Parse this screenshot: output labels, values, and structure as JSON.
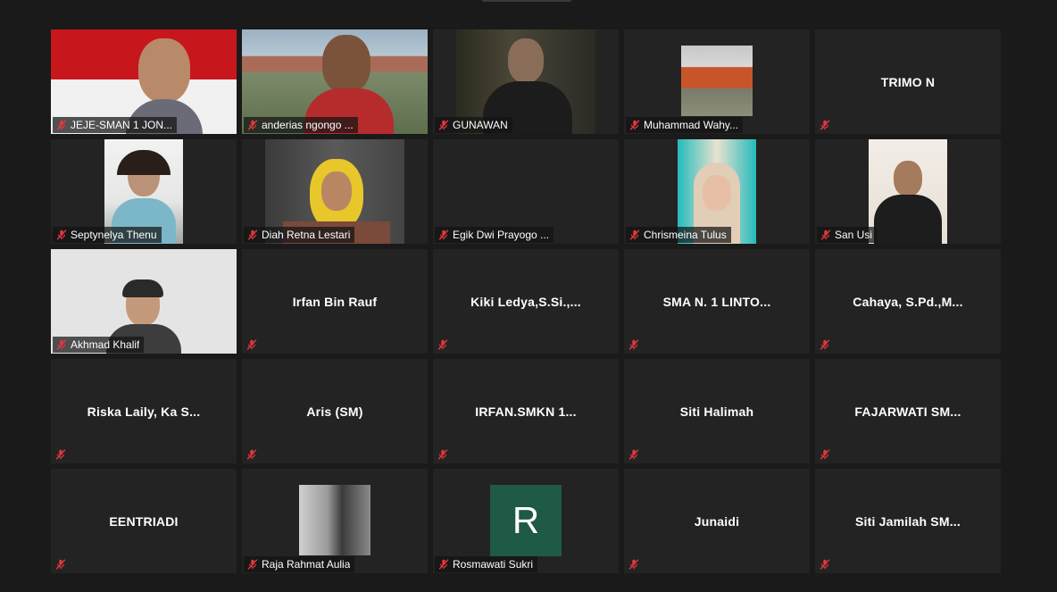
{
  "participants": [
    {
      "name": "JEJE-SMAN 1 JON...",
      "has_video": true,
      "video_style": "flag"
    },
    {
      "name": "anderias ngongo ...",
      "has_video": true,
      "video_style": "outdoor"
    },
    {
      "name": "GUNAWAN",
      "has_video": true,
      "video_style": "dark-room"
    },
    {
      "name": "Muhammad Wahy...",
      "has_video": true,
      "video_style": "building"
    },
    {
      "name": "TRIMO  N",
      "has_video": false,
      "show_name_label": false
    },
    {
      "name": "Septynelya Thenu",
      "has_video": true,
      "video_style": "portrait-light"
    },
    {
      "name": "Diah Retna Lestari",
      "has_video": true,
      "video_style": "portrait-yellow"
    },
    {
      "name": "Egik Dwi Prayogo ...",
      "has_video": true,
      "video_style": "blank"
    },
    {
      "name": "Chrismeina Tulus",
      "has_video": true,
      "video_style": "portrait-teal"
    },
    {
      "name": "San Usi",
      "has_video": true,
      "video_style": "portrait-dark"
    },
    {
      "name": "Akhmad Khalif",
      "has_video": true,
      "video_style": "portrait-wall"
    },
    {
      "name": "Irfan Bin Rauf",
      "has_video": false,
      "show_name_label": false
    },
    {
      "name": "Kiki  Ledya,S.Si.,...",
      "has_video": false,
      "show_name_label": false
    },
    {
      "name": "SMA N. 1 LINTO...",
      "has_video": false,
      "show_name_label": false
    },
    {
      "name": "Cahaya,  S.Pd.,M...",
      "has_video": false,
      "show_name_label": false
    },
    {
      "name": "Riska Laily, Ka S...",
      "has_video": false,
      "show_name_label": false
    },
    {
      "name": "Aris (SM)",
      "has_video": false,
      "show_name_label": false
    },
    {
      "name": "IRFAN.SMKN  1...",
      "has_video": false,
      "show_name_label": false
    },
    {
      "name": "Siti Halimah",
      "has_video": false,
      "show_name_label": false
    },
    {
      "name": "FAJARWATI SM...",
      "has_video": false,
      "show_name_label": false
    },
    {
      "name": "EENTRIADI",
      "has_video": false,
      "show_name_label": false
    },
    {
      "name": "Raja Rahmat Aulia",
      "has_video": true,
      "video_style": "bw-photo"
    },
    {
      "name": "Rosmawati Sukri",
      "has_video": true,
      "video_style": "avatar-letter",
      "avatar_letter": "R"
    },
    {
      "name": "Junaidi",
      "has_video": false,
      "show_name_label": false
    },
    {
      "name": "Siti  Jamilah  SM...",
      "has_video": false,
      "show_name_label": false
    }
  ],
  "colors": {
    "background": "#1a1a1a",
    "tile": "#232323",
    "muted_icon": "#e0383e",
    "avatar_bg": "#1e5a46"
  },
  "icons": {
    "muted": "microphone-muted-icon"
  }
}
